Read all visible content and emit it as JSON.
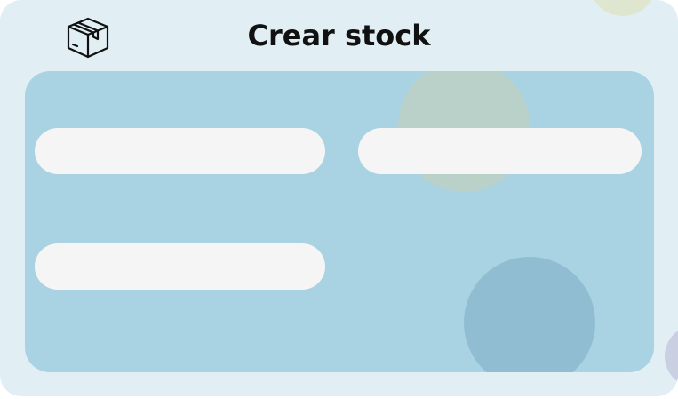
{
  "header": {
    "title": "Crear stock",
    "icon": "package-box-icon"
  },
  "form": {
    "fields": [
      {
        "value": "",
        "placeholder": ""
      },
      {
        "value": "",
        "placeholder": ""
      },
      {
        "value": "",
        "placeholder": ""
      }
    ]
  },
  "colors": {
    "card_background": "#e1eff5",
    "panel_background": "#a9d3e3",
    "field_background": "#f5f5f5",
    "title_text": "#111111"
  }
}
